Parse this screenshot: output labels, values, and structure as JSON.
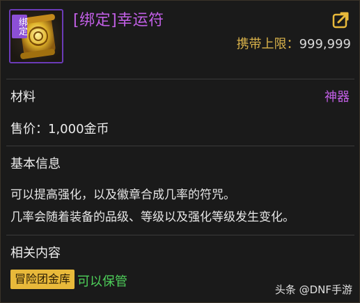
{
  "item": {
    "badge": "绑定",
    "name": "[绑定]幸运符",
    "carry_label": "携带上限：",
    "carry_value": "999,999"
  },
  "info": {
    "material_label": "材料",
    "rarity": "神器",
    "price": "售价：1,000金币"
  },
  "basic": {
    "title": "基本信息",
    "lines": [
      "可以提高强化，以及徽章合成几率的符咒。",
      "几率会随着装备的品级、等级以及强化等级发生变化。"
    ]
  },
  "related": {
    "title": "相关内容",
    "tag_label": "冒险团金库",
    "status": "可以保管"
  },
  "watermark": "头条 @DNF手游",
  "colors": {
    "rarity_purple": "#c25fe6",
    "gold": "#d9b24a",
    "green": "#4ed05a",
    "tag_bg": "#e8b93a"
  },
  "icons": {
    "item": "scroll-icon",
    "share": "share-icon"
  }
}
